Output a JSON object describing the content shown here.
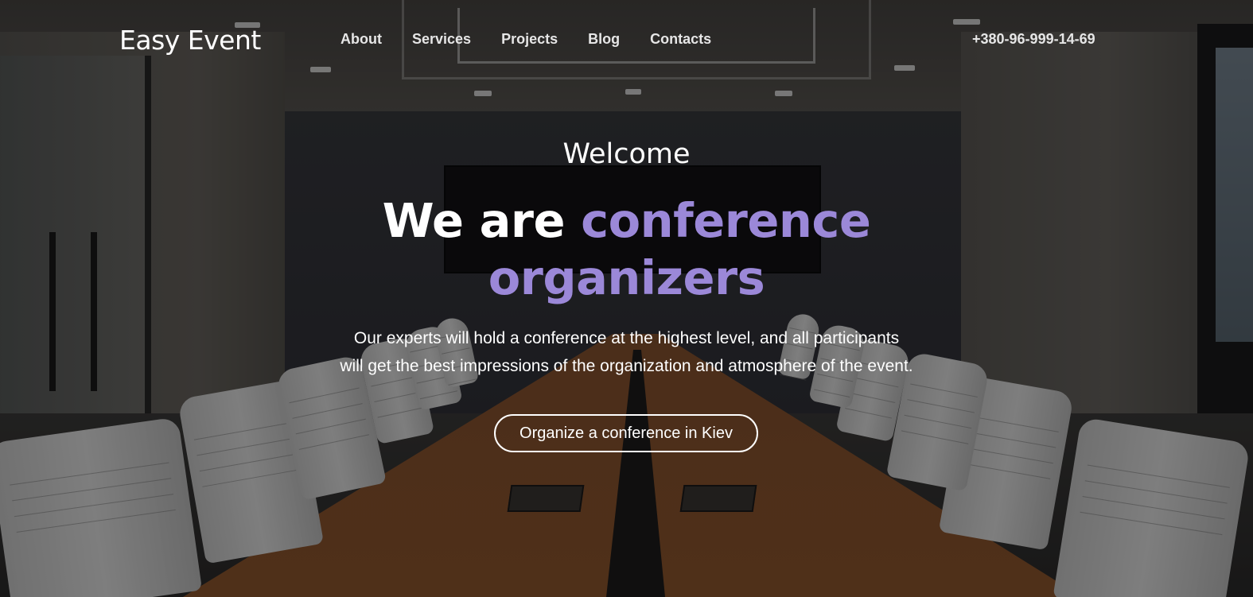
{
  "header": {
    "logo": "Easy Event",
    "nav": [
      "About",
      "Services",
      "Projects",
      "Blog",
      "Contacts"
    ],
    "phone": "+380-96-999-14-69"
  },
  "hero": {
    "welcome": "Welcome",
    "headline_plain": "We are",
    "headline_accent_1": "conference",
    "headline_accent_2": "organizers",
    "description_line_1": "Our experts will hold a conference at the highest level, and all participants",
    "description_line_2": "will get the best impressions of the organization and atmosphere of the event.",
    "cta_label": "Organize a conference in Kiev"
  },
  "colors": {
    "accent": "#9b88d8",
    "overlay": "rgba(0,0,0,0.46)",
    "text": "#ffffff"
  }
}
